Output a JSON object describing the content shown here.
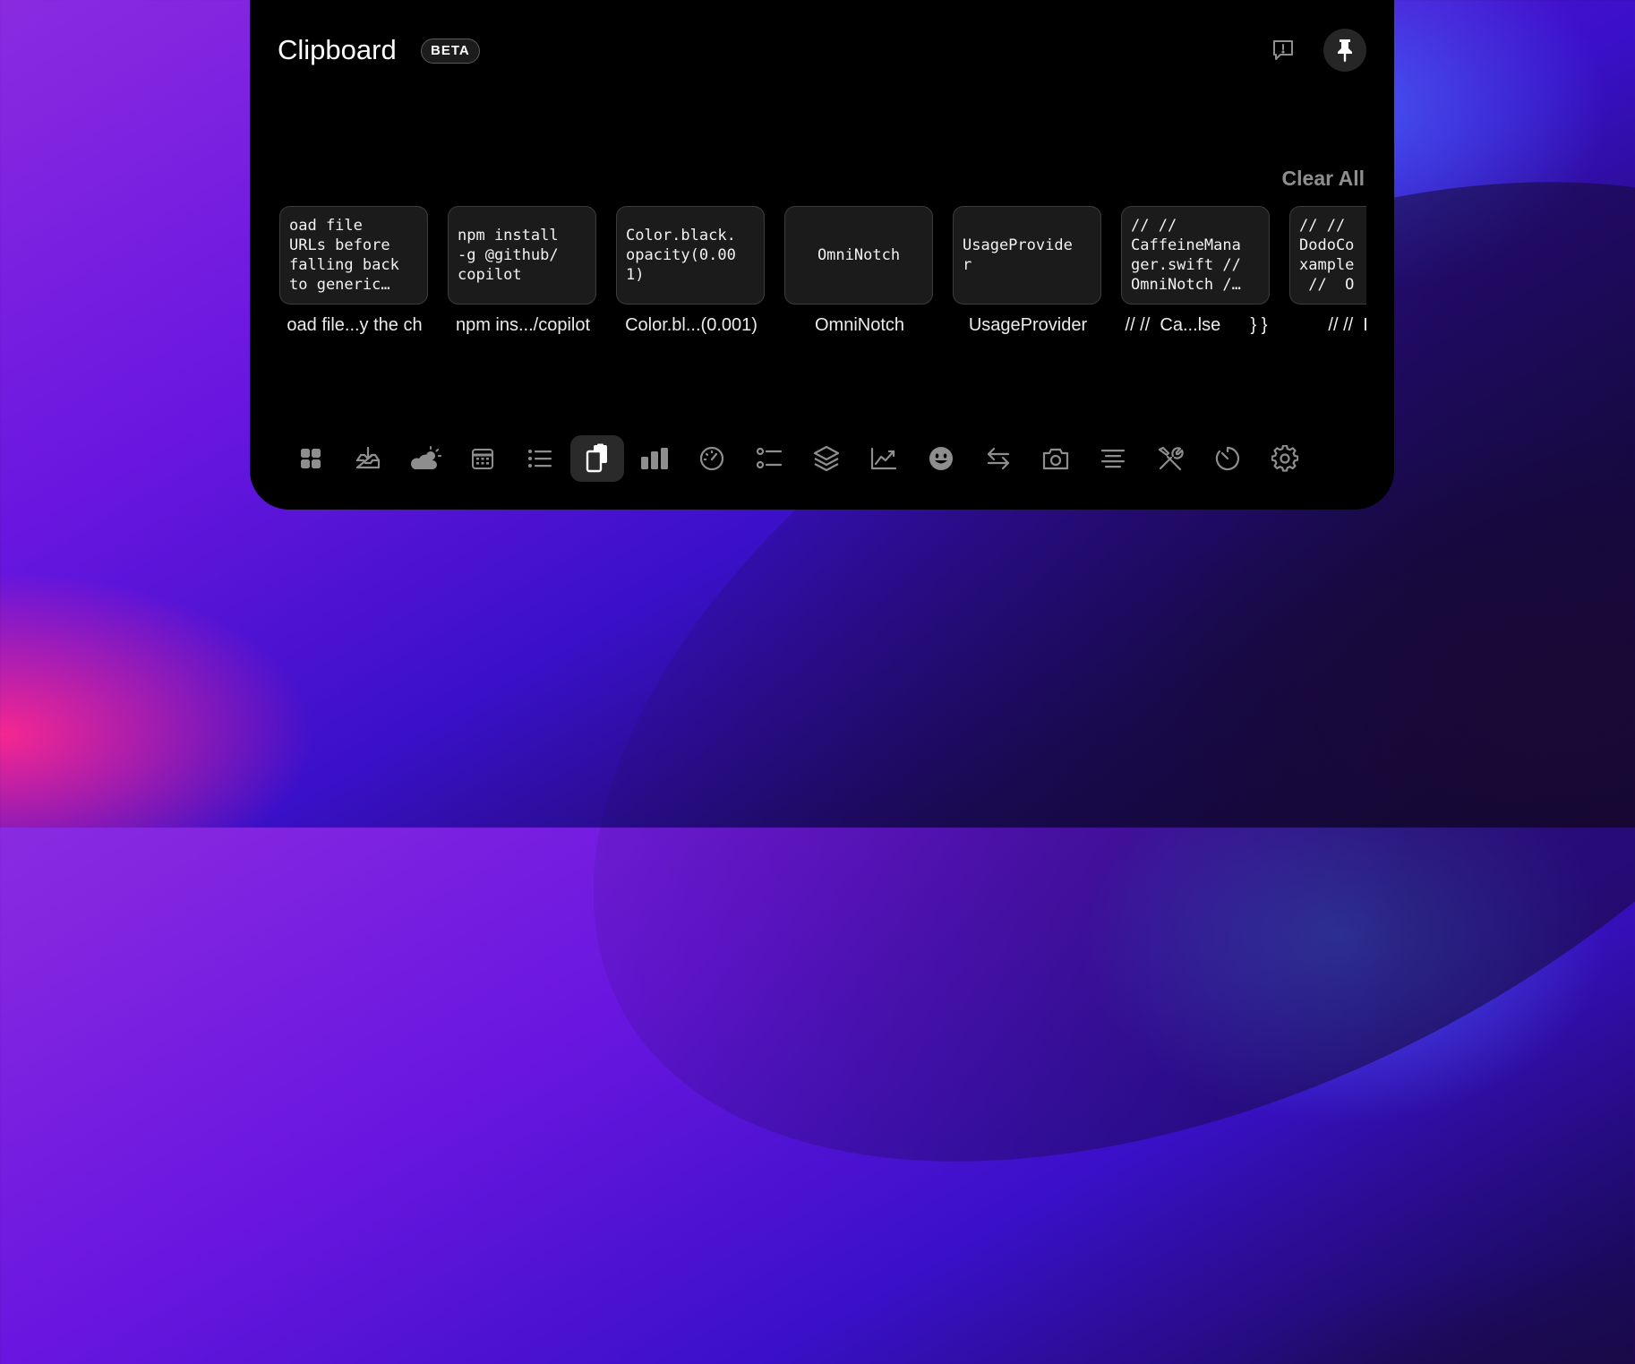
{
  "header": {
    "title": "Clipboard",
    "badge": "BETA",
    "feedback_icon": "feedback-icon",
    "pin_icon": "pin-icon"
  },
  "clear_all": "Clear All",
  "items": [
    {
      "preview": "oad file\nURLs before\nfalling back\nto generic…",
      "caption": "oad file...y the ch"
    },
    {
      "preview": "npm install\n-g @github/\ncopilot",
      "caption": "npm ins.../copilot"
    },
    {
      "preview": "Color.black.\nopacity(0.00\n1)",
      "caption": "Color.bl...(0.001)"
    },
    {
      "preview": "OmniNotch",
      "caption": "OmniNotch"
    },
    {
      "preview": "UsageProvide\nr",
      "caption": "UsageProvider"
    },
    {
      "preview": "// //\nCaffeineMana\nger.swift //\nOmniNotch /…",
      "caption": "// //  Ca...lse      } }"
    },
    {
      "preview": "// //\nDodoCo\nxample\n //  O",
      "caption": "// //  Do..."
    }
  ],
  "dock": [
    {
      "icon": "widgets-grid-icon",
      "active": false
    },
    {
      "icon": "downloads-tray-icon",
      "active": false
    },
    {
      "icon": "weather-icon",
      "active": false
    },
    {
      "icon": "calendar-icon",
      "active": false
    },
    {
      "icon": "list-icon",
      "active": false
    },
    {
      "icon": "clipboard-icon",
      "active": true
    },
    {
      "icon": "bar-chart-icon",
      "active": false
    },
    {
      "icon": "speedometer-icon",
      "active": false
    },
    {
      "icon": "checklist-icon",
      "active": false
    },
    {
      "icon": "layers-icon",
      "active": false
    },
    {
      "icon": "line-chart-icon",
      "active": false
    },
    {
      "icon": "emoji-icon",
      "active": false
    },
    {
      "icon": "transfer-arrows-icon",
      "active": false
    },
    {
      "icon": "camera-icon",
      "active": false
    },
    {
      "icon": "text-align-icon",
      "active": false
    },
    {
      "icon": "tools-icon",
      "active": false
    },
    {
      "icon": "timer-icon",
      "active": false
    },
    {
      "icon": "settings-gear-icon",
      "active": false
    }
  ],
  "colors": {
    "panel": "#000000",
    "card_bg": "#1b1b1b",
    "icon": "#8e8e8e",
    "active_icon": "#ffffff"
  }
}
